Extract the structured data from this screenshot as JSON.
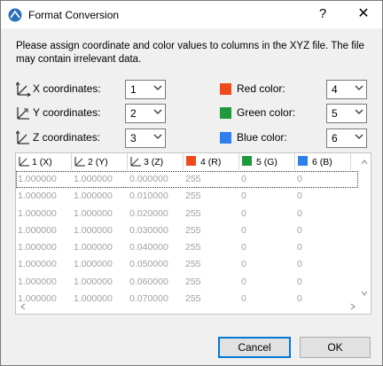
{
  "window": {
    "title": "Format Conversion",
    "help": "?",
    "close": "✕"
  },
  "description": "Please assign coordinate and color values to columns in the XYZ file. The file may contain irrelevant data.",
  "coordinates": [
    {
      "label": "X coordinates:",
      "value": "1"
    },
    {
      "label": "Y coordinates:",
      "value": "2"
    },
    {
      "label": "Z coordinates:",
      "value": "3"
    }
  ],
  "colors": [
    {
      "label": "Red color:",
      "value": "4",
      "color": "#f04a1a"
    },
    {
      "label": "Green color:",
      "value": "5",
      "color": "#1e9a3c"
    },
    {
      "label": "Blue color:",
      "value": "6",
      "color": "#2f7fef"
    }
  ],
  "table": {
    "headers": [
      "1 (X)",
      "2 (Y)",
      "3 (Z)",
      "4 (R)",
      "5 (G)",
      "6 (B)"
    ],
    "rows": [
      [
        "1.000000",
        "1.000000",
        "0.000000",
        "255",
        "0",
        "0"
      ],
      [
        "1.000000",
        "1.000000",
        "0.010000",
        "255",
        "0",
        "0"
      ],
      [
        "1.000000",
        "1.000000",
        "0.020000",
        "255",
        "0",
        "0"
      ],
      [
        "1.000000",
        "1.000000",
        "0.030000",
        "255",
        "0",
        "0"
      ],
      [
        "1.000000",
        "1.000000",
        "0.040000",
        "255",
        "0",
        "0"
      ],
      [
        "1.000000",
        "1.000000",
        "0.050000",
        "255",
        "0",
        "0"
      ],
      [
        "1.000000",
        "1.000000",
        "0.060000",
        "255",
        "0",
        "0"
      ],
      [
        "1.000000",
        "1.000000",
        "0.070000",
        "255",
        "0",
        "0"
      ]
    ]
  },
  "buttons": {
    "cancel": "Cancel",
    "ok": "OK"
  },
  "colors_theme": {
    "accent": "#0078d7",
    "muted_text": "#a0a0a0"
  },
  "icons": {
    "app": "archicad-icon",
    "axis": "axis-icon",
    "dropdown": "chevron-down-icon"
  }
}
